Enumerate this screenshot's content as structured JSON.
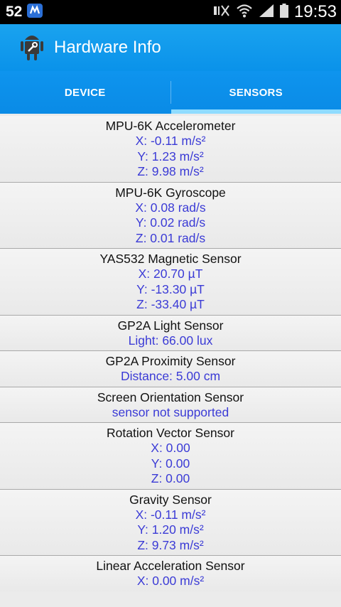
{
  "statusbar": {
    "notification_count": "52",
    "time": "19:53",
    "icons": [
      "bluetooth-app-icon",
      "mute-icon",
      "wifi-icon",
      "signal-icon",
      "battery-icon"
    ]
  },
  "appbar": {
    "title": "Hardware Info",
    "icon": "android-wrench-icon"
  },
  "tabs": [
    {
      "label": "DEVICE",
      "active": false
    },
    {
      "label": "SENSORS",
      "active": true
    }
  ],
  "colors": {
    "accent": "#0a92ea",
    "tab_indicator": "#8fdcff",
    "value_text": "#3b3bd6"
  },
  "sensors": [
    {
      "name": "MPU-6K Accelerometer",
      "values": [
        "X: -0.11 m/s²",
        "Y: 1.23 m/s²",
        "Z: 9.98 m/s²"
      ]
    },
    {
      "name": "MPU-6K Gyroscope",
      "values": [
        "X: 0.08 rad/s",
        "Y: 0.02 rad/s",
        "Z: 0.01 rad/s"
      ]
    },
    {
      "name": "YAS532 Magnetic Sensor",
      "values": [
        "X: 20.70 µT",
        "Y: -13.30 µT",
        "Z: -33.40 µT"
      ]
    },
    {
      "name": "GP2A Light Sensor",
      "values": [
        "Light: 66.00 lux"
      ]
    },
    {
      "name": "GP2A Proximity Sensor",
      "values": [
        "Distance: 5.00 cm"
      ]
    },
    {
      "name": "Screen Orientation Sensor",
      "values": [
        "sensor not supported"
      ]
    },
    {
      "name": "Rotation Vector Sensor",
      "values": [
        "X: 0.00",
        "Y: 0.00",
        "Z: 0.00"
      ]
    },
    {
      "name": "Gravity Sensor",
      "values": [
        "X: -0.11 m/s²",
        "Y: 1.20 m/s²",
        "Z: 9.73 m/s²"
      ]
    },
    {
      "name": "Linear Acceleration Sensor",
      "values": [
        "X: 0.00 m/s²"
      ]
    }
  ]
}
